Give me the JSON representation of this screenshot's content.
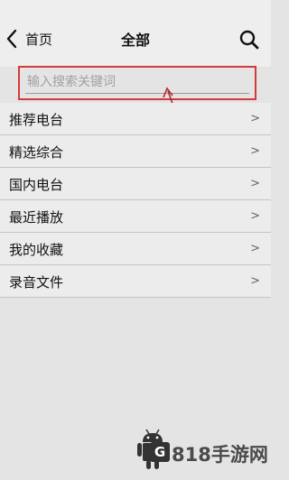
{
  "header": {
    "back_label": "首页",
    "title": "全部",
    "back_icon": "chevron-left-icon",
    "search_icon": "search-icon"
  },
  "search": {
    "placeholder": "输入搜索关键词",
    "value": ""
  },
  "menu": {
    "items": [
      {
        "label": "推荐电台",
        "chevron": ">"
      },
      {
        "label": "精选综合",
        "chevron": ">"
      },
      {
        "label": "国内电台",
        "chevron": ">"
      },
      {
        "label": "最近播放",
        "chevron": ">"
      },
      {
        "label": "我的收藏",
        "chevron": ">"
      },
      {
        "label": "录音文件",
        "chevron": ">"
      }
    ]
  },
  "annotation": {
    "highlight_color": "#d23b3b",
    "arrow_color": "#b22a2a"
  },
  "watermark": {
    "logo_letter": "G",
    "text": "818手游网"
  }
}
